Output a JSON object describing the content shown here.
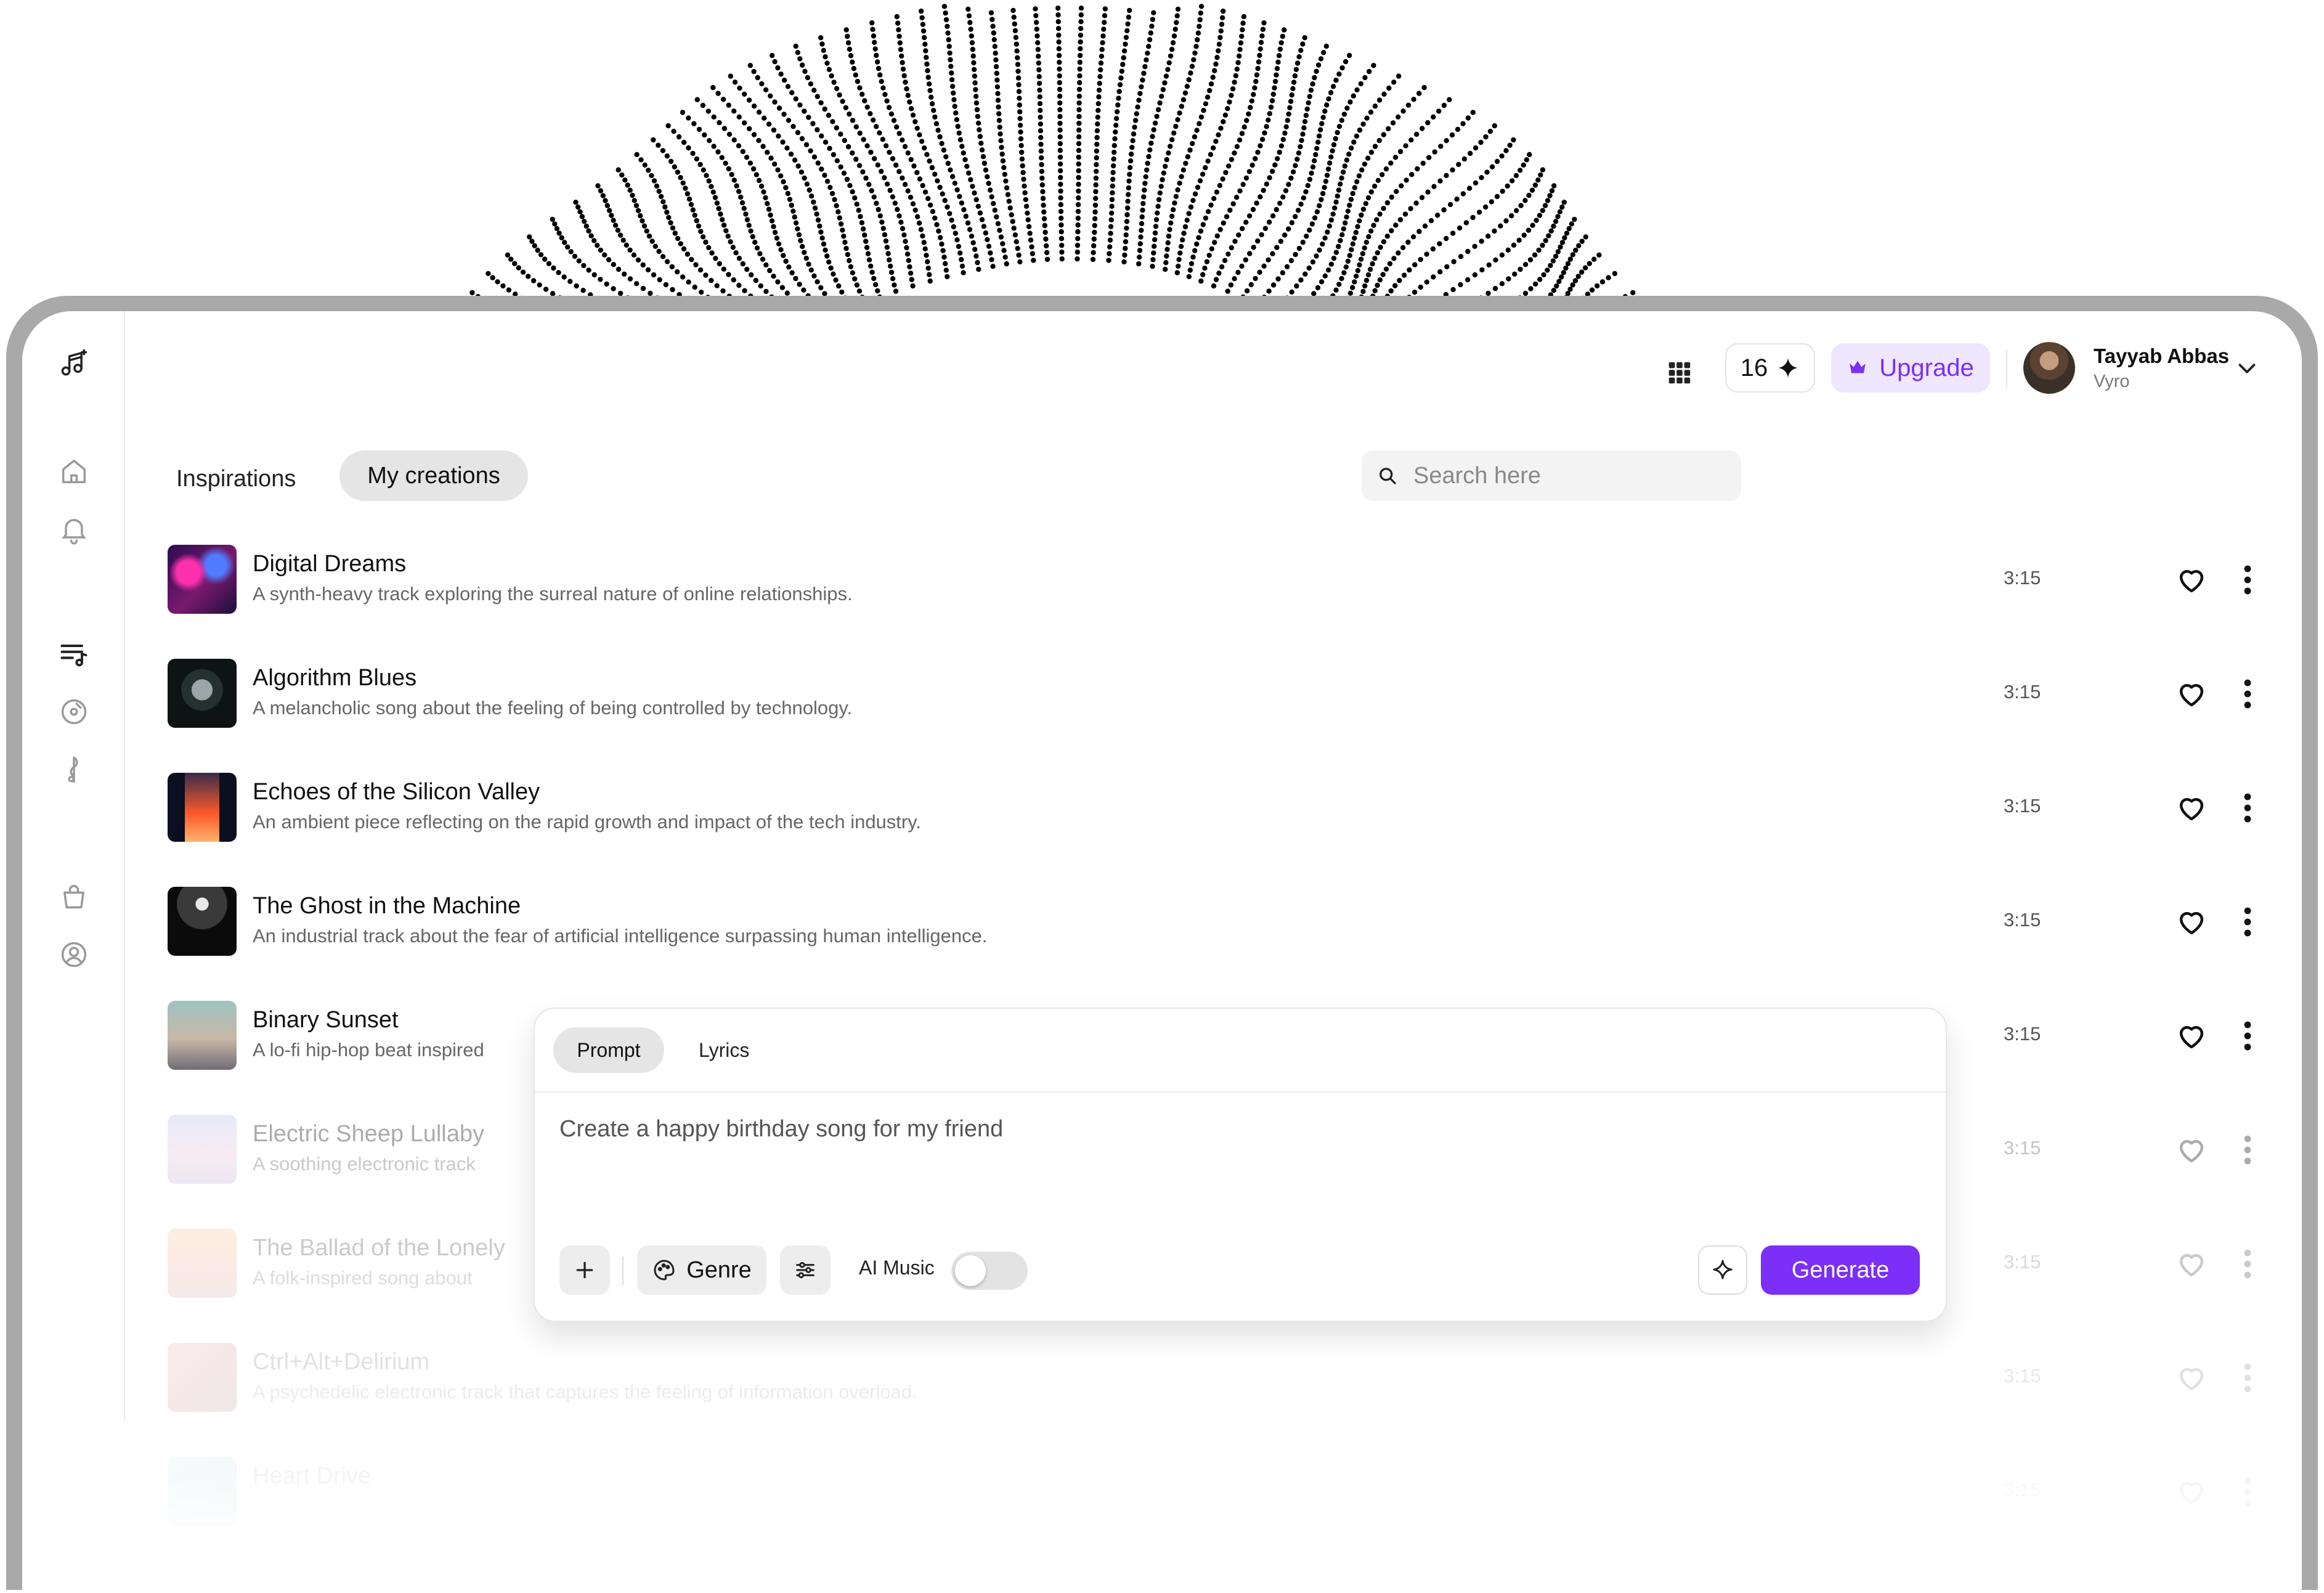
{
  "app": {
    "logo_icon": "music-note-sparkle-icon"
  },
  "sidebar": {
    "items": [
      {
        "name": "home",
        "icon": "home-icon"
      },
      {
        "name": "notifications",
        "icon": "bell-icon"
      },
      {
        "name": "playlist",
        "icon": "playlist-music-icon"
      },
      {
        "name": "vinyl",
        "icon": "disc-icon"
      },
      {
        "name": "music-note",
        "icon": "music-note-icon"
      },
      {
        "name": "shop",
        "icon": "shopping-bag-icon"
      },
      {
        "name": "profile",
        "icon": "user-circle-icon"
      }
    ]
  },
  "header": {
    "credits": "16",
    "upgrade_label": "Upgrade",
    "user": {
      "name": "Tayyab Abbas",
      "org": "Vyro"
    }
  },
  "tabs": [
    {
      "label": "Inspirations",
      "active": false
    },
    {
      "label": "My creations",
      "active": true
    }
  ],
  "search": {
    "placeholder": "Search here"
  },
  "songs": [
    {
      "title": "Digital Dreams",
      "description": "A synth-heavy track exploring the surreal nature of online relationships.",
      "duration": "3:15"
    },
    {
      "title": "Algorithm Blues",
      "description": "A melancholic song about the feeling of being controlled by technology.",
      "duration": "3:15"
    },
    {
      "title": "Echoes of the Silicon Valley",
      "description": "An ambient piece reflecting on the rapid growth and impact of the tech industry.",
      "duration": "3:15"
    },
    {
      "title": "The Ghost in the Machine",
      "description": "An industrial track about the fear of artificial intelligence surpassing human intelligence.",
      "duration": "3:15"
    },
    {
      "title": "Binary Sunset",
      "description": "A lo-fi hip-hop beat inspired",
      "duration": "3:15"
    },
    {
      "title": "Electric Sheep Lullaby",
      "description": "A soothing electronic track",
      "duration": "3:15"
    },
    {
      "title": "The Ballad of the Lonely",
      "description": "A folk-inspired song about",
      "duration": "3:15"
    },
    {
      "title": "Ctrl+Alt+Delirium",
      "description": "A psychedelic electronic track that captures the feeling of information overload.",
      "duration": "3:15"
    },
    {
      "title": "Heart Drive",
      "description": "",
      "duration": "3:15"
    }
  ],
  "composer": {
    "tabs": [
      {
        "label": "Prompt",
        "active": true
      },
      {
        "label": "Lyrics",
        "active": false
      }
    ],
    "prompt_text": "Create a happy birthday song for my friend",
    "genre_label": "Genre",
    "ai_music_label": "AI Music",
    "ai_music_on": false,
    "generate_label": "Generate"
  },
  "colors": {
    "accent": "#7b2ff7",
    "accent_soft": "#efe6ff"
  }
}
